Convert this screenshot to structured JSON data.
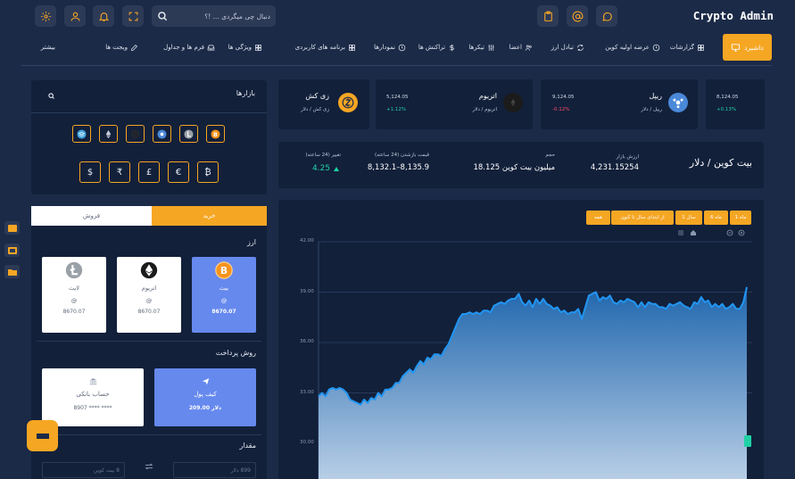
{
  "app": {
    "title": "Crypto Admin"
  },
  "search": {
    "placeholder": "دنبال چی میگردی ... !؟"
  },
  "nav": {
    "active": "داشبرد",
    "items": [
      "گزارشات",
      "عرضه اولیه کوین",
      "تبادل ارز",
      "اعضا",
      "تیکرها",
      "تراکنش ها",
      "نمودارها",
      "برنامه های کاربردی",
      "ویژگی ها",
      "فرم ها و جداول",
      "ویجت ها",
      "بیشتر"
    ]
  },
  "markets": {
    "title": "بازارها",
    "currencies": [
      "$",
      "₹",
      "£",
      "€",
      "₿"
    ]
  },
  "tickers": [
    {
      "name": "زی کش",
      "sub": "زی کش / دلار",
      "price": "",
      "change": ""
    },
    {
      "name": "اتریوم",
      "sub": "اتریوم / دلار",
      "price": "5,124.05",
      "change": "+1.12%"
    },
    {
      "name": "ریپل",
      "sub": "ریپل / دلار",
      "price": "9,124.05",
      "change": "-0.12%"
    },
    {
      "name": "",
      "sub": "",
      "price": "8,124.05",
      "change": "+0.13%"
    }
  ],
  "pair": {
    "title": "بیت کوین / دلار",
    "market_value_label": "ارزش بازار",
    "market_value": "4,231.15254",
    "volume_label": "حجم",
    "volume": "18.125 میلیون بیت کوین",
    "range_label": "قیمت بازشدن (24 ساعته)",
    "range": "8,132.1–8,135.9",
    "change_label": "تغییر (24 ساعته)",
    "change": "4.25"
  },
  "chart_controls": {
    "ranges": [
      "1 ماه",
      "6 ماه",
      "1 سال",
      "از ابتدای سال تا کنون",
      "همه"
    ]
  },
  "chart_data": {
    "type": "area",
    "ylim": [
      30,
      42
    ],
    "yticks": [
      "42.00",
      "39.00",
      "36.00",
      "33.00",
      "30.00"
    ],
    "values": [
      32.8,
      33.0,
      32.8,
      33.2,
      33.3,
      33.2,
      33.3,
      33.2,
      33.0,
      32.6,
      32.5,
      32.4,
      32.3,
      32.6,
      32.4,
      32.7,
      32.6,
      33.0,
      32.8,
      33.2,
      33.2,
      33.3,
      33.6,
      33.6,
      34.0,
      34.2,
      34.4,
      34.2,
      34.6,
      34.9,
      34.7,
      35.1,
      35.0,
      35.3,
      35.3,
      35.2,
      35.6,
      35.9,
      36.4,
      36.9,
      37.4,
      37.7,
      37.7,
      37.8,
      37.7,
      37.8,
      37.7,
      37.9,
      37.9,
      37.8,
      38.2,
      38.3,
      38.4,
      38.3,
      38.5,
      38.6,
      38.6,
      38.9,
      38.4,
      38.2,
      38.5,
      38.1,
      38.6,
      38.3,
      38.6,
      38.3,
      38.2,
      38.0,
      38.1,
      37.8,
      37.9,
      37.7,
      37.8,
      37.8,
      38.0,
      37.4,
      38.1,
      38.8,
      38.9,
      39.0,
      38.5,
      38.7,
      38.6,
      38.8,
      38.4,
      38.3,
      38.5,
      38.4,
      38.6,
      38.5,
      38.4,
      38.1,
      38.4,
      38.1,
      38.4,
      38.3,
      38.3,
      38.1,
      38.1,
      38.0,
      38.3,
      38.2,
      38.3,
      38.4,
      38.2,
      38.1,
      38.0,
      38.4,
      38.3,
      38.7,
      38.4,
      38.5,
      38.1,
      38.3,
      38.1,
      38.3,
      38.0,
      38.1,
      38.3,
      38.0,
      38.0,
      38.4,
      39.3
    ],
    "colors": {
      "line": "#2196f3",
      "fill_top": "#1f66ad",
      "fill_bottom": "#b8cee6"
    }
  },
  "trade": {
    "buy_label": "خرید",
    "sell_label": "فروش",
    "currency_title": "ارز",
    "wallets": [
      {
        "name": "بیت",
        "at": "@",
        "amount": "8670.07"
      },
      {
        "name": "اتریوم",
        "at": "@",
        "amount": "8670.07"
      },
      {
        "name": "لایت",
        "at": "@",
        "amount": "8670.07"
      }
    ],
    "payment_title": "روش پرداخت",
    "payments": [
      {
        "name": "کیف پول",
        "amount": "209.00 دلار"
      },
      {
        "name": "حساب بانکی",
        "amount": "8907 **** ****"
      }
    ],
    "amount_title": "مقدار",
    "amount_placeholder_left": "899 دلار",
    "amount_placeholder_right": "8 بیت کوین"
  },
  "colors": {
    "accent": "#f5a623",
    "panel": "#12203a",
    "bg": "#1b2a47"
  }
}
